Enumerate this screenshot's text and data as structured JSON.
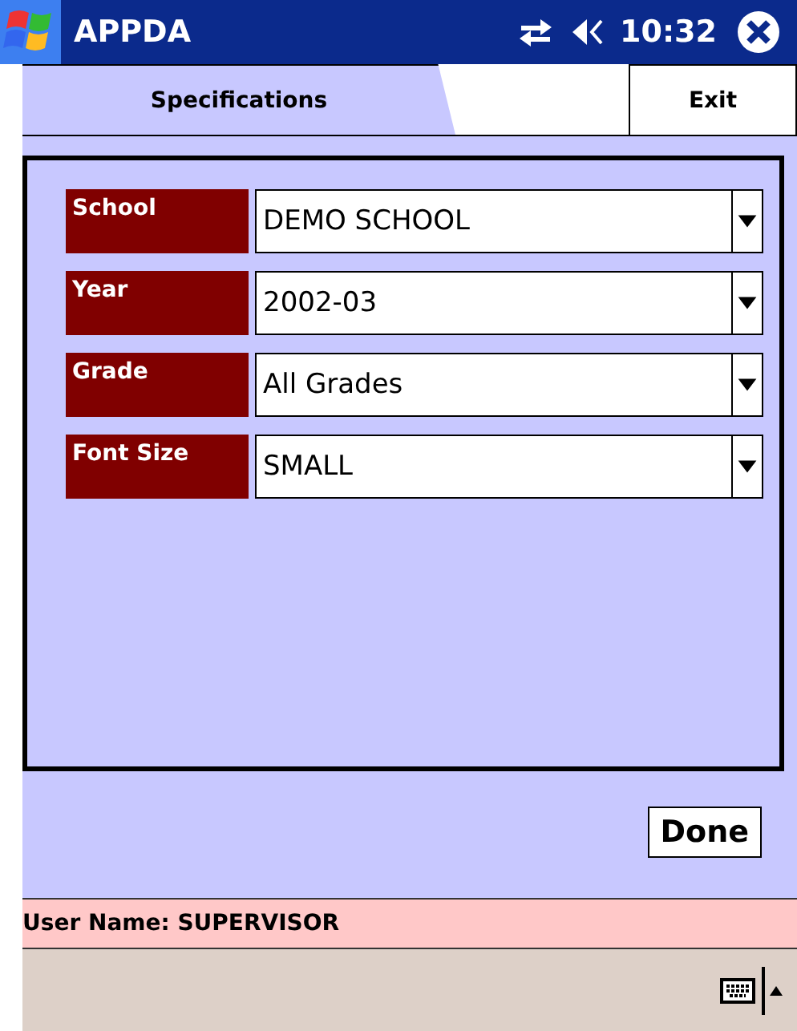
{
  "title_bar": {
    "title": "APPDA",
    "time": "10:32"
  },
  "tabs": [
    {
      "label": "Specifications",
      "selected": true
    },
    {
      "label": "Exit",
      "selected": false
    }
  ],
  "fields": [
    {
      "label": "School",
      "value": "DEMO SCHOOL"
    },
    {
      "label": "Year",
      "value": "2002-03"
    },
    {
      "label": "Grade",
      "value": "All Grades"
    },
    {
      "label": "Font Size",
      "value": "SMALL"
    }
  ],
  "done_button": "Done",
  "status_bar": "User Name: SUPERVISOR"
}
